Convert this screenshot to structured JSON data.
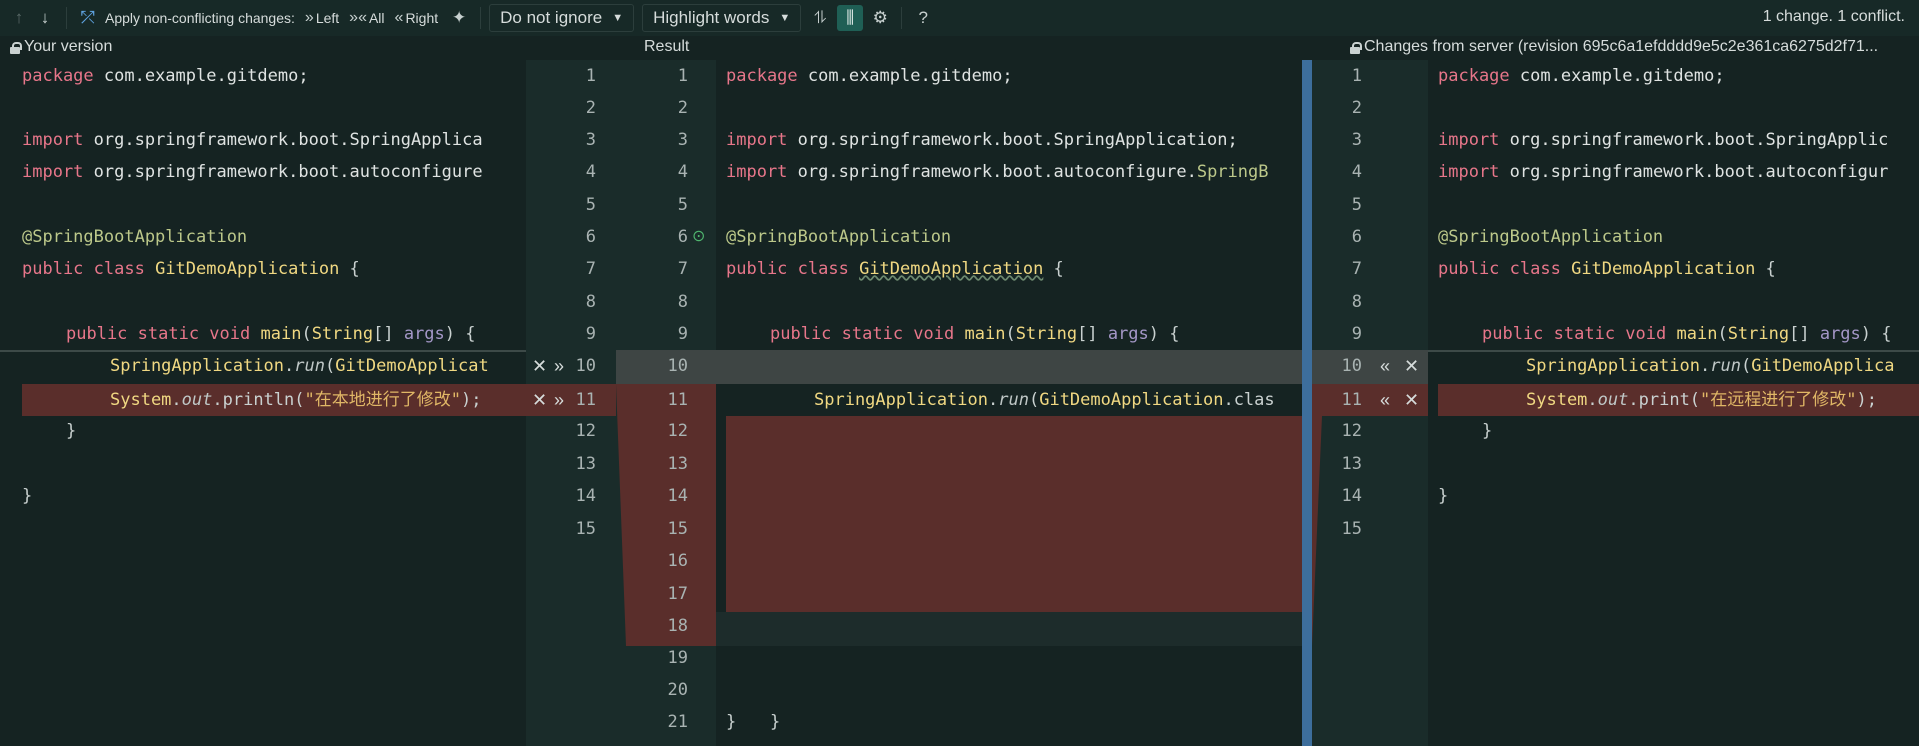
{
  "toolbar": {
    "apply_label": "Apply non-conflicting changes:",
    "left_label": "Left",
    "all_label": "All",
    "right_label": "Right",
    "ignore_dropdown": "Do not ignore",
    "highlight_dropdown": "Highlight words",
    "status": "1 change. 1 conflict.",
    "icons": [
      "arrow-up-icon",
      "arrow-down-icon",
      "merge-icon",
      "magic-wand-icon",
      "collapse-icon",
      "sync-scroll-icon",
      "gear-icon",
      "help-icon"
    ]
  },
  "headers": {
    "left": "Your version",
    "center": "Result",
    "right": "Changes from server (revision 695c6a1efdddd9e5c2e361ca6275d2f71..."
  },
  "left_lines": {
    "l1a": "package",
    "l1b": " com.example.gitdemo;",
    "l3a": "import",
    "l3b": " org.springframework.boot.SpringApplica",
    "l4a": "import",
    "l4b": " org.springframework.boot.autoconfigure",
    "l6": "@SpringBootApplication",
    "l7a": "public class",
    "l7b": "GitDemoApplication",
    "l7c": " {",
    "l9a": "public static void",
    "l9b": "main",
    "l9c": "(",
    "l9d": "String",
    "l9e": "[] ",
    "l9f": "args",
    "l9g": ") {",
    "l10a": "SpringApplication",
    "l10b": ".",
    "l10c": "run",
    "l10d": "(",
    "l10e": "GitDemoApplicat",
    "l11a": "System",
    "l11b": ".",
    "l11c": "out",
    "l11d": ".println(",
    "l11e": "\"在本地进行了修改\"",
    "l11f": ");",
    "l12": "}",
    "l14": "}"
  },
  "center_lines": {
    "l1a": "package",
    "l1b": " com.example.gitdemo;",
    "l3a": "import",
    "l3b": " org.springframework.boot.SpringApplication;",
    "l4a": "import",
    "l4b": " org.springframework.boot.autoconfigure.",
    "l4c": "SpringB",
    "l6": "@SpringBootApplication",
    "l7a": "public class",
    "l7b": "GitDemoApplication",
    "l7c": " {",
    "l9a": "public static void",
    "l9b": "main",
    "l9c": "(",
    "l9d": "String",
    "l9e": "[] ",
    "l9f": "args",
    "l9g": ") {",
    "l11a": "SpringApplication",
    "l11b": ".",
    "l11c": "run",
    "l11d": "(",
    "l11e": "GitDemoApplication",
    "l11f": ".clas",
    "l19": "}",
    "l21": "}"
  },
  "right_lines": {
    "l1a": "package",
    "l1b": " com.example.gitdemo;",
    "l3a": "import",
    "l3b": " org.springframework.boot.SpringApplic",
    "l4a": "import",
    "l4b": " org.springframework.boot.autoconfigur",
    "l6": "@SpringBootApplication",
    "l7a": "public class",
    "l7b": "GitDemoApplication",
    "l7c": " {",
    "l9a": "public static void",
    "l9b": "main",
    "l9c": "(",
    "l9d": "String",
    "l9e": "[] ",
    "l9f": "args",
    "l9g": ") {",
    "l10a": "SpringApplication",
    "l10b": ".",
    "l10c": "run",
    "l10d": "(",
    "l10e": "GitDemoApplica",
    "l11a": "System",
    "l11b": ".",
    "l11c": "out",
    "l11d": ".print(",
    "l11e": "\"在远程进行了修改\"",
    "l11f": ");",
    "l12": "}",
    "l14": "}"
  },
  "gutter_left": [
    "1",
    "2",
    "3",
    "4",
    "5",
    "6",
    "7",
    "8",
    "9",
    "10",
    "11",
    "12",
    "13",
    "14",
    "15"
  ],
  "gutter_center": [
    "1",
    "2",
    "3",
    "4",
    "5",
    "6",
    "7",
    "8",
    "9",
    "10",
    "11",
    "12",
    "13",
    "14",
    "15",
    "16",
    "17",
    "18",
    "19",
    "20",
    "21"
  ],
  "gutter_right": [
    "1",
    "2",
    "3",
    "4",
    "5",
    "6",
    "7",
    "8",
    "9",
    "10",
    "11",
    "12",
    "13",
    "14",
    "15"
  ],
  "colors": {
    "background": "#152322",
    "conflict": "#5a2e2b",
    "keyword": "#e7768a",
    "class_name": "#f0d882",
    "string": "#e0b766",
    "annotation": "#bcc88a"
  }
}
